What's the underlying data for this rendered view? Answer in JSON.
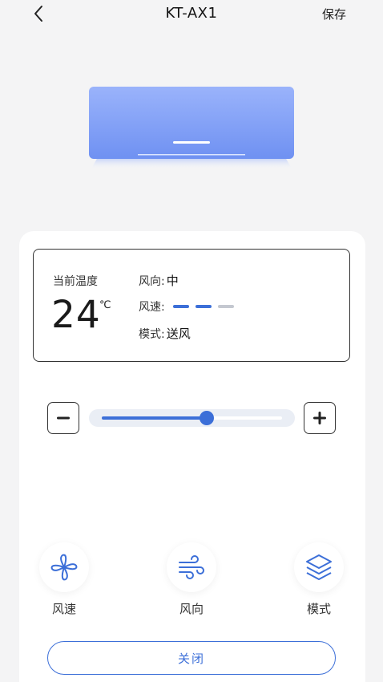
{
  "header": {
    "title": "KT-AX1",
    "save_label": "保存"
  },
  "status": {
    "current_temp_label": "当前温度",
    "temperature": "24",
    "unit": "℃",
    "wind_direction_label": "风向:",
    "wind_direction_value": "中",
    "wind_speed_label": "风速:",
    "wind_speed_level": 2,
    "wind_speed_max": 3,
    "mode_label": "模式:",
    "mode_value": "送风"
  },
  "slider": {
    "level_fraction": 0.58
  },
  "functions": [
    {
      "label": "风速",
      "icon": "fan-icon"
    },
    {
      "label": "风向",
      "icon": "wind-icon"
    },
    {
      "label": "模式",
      "icon": "layers-icon"
    }
  ],
  "power": {
    "label": "关闭"
  },
  "colors": {
    "accent": "#3c6fd8",
    "ac_body": "#7f9ef6",
    "inactive": "#c4c8d0"
  }
}
